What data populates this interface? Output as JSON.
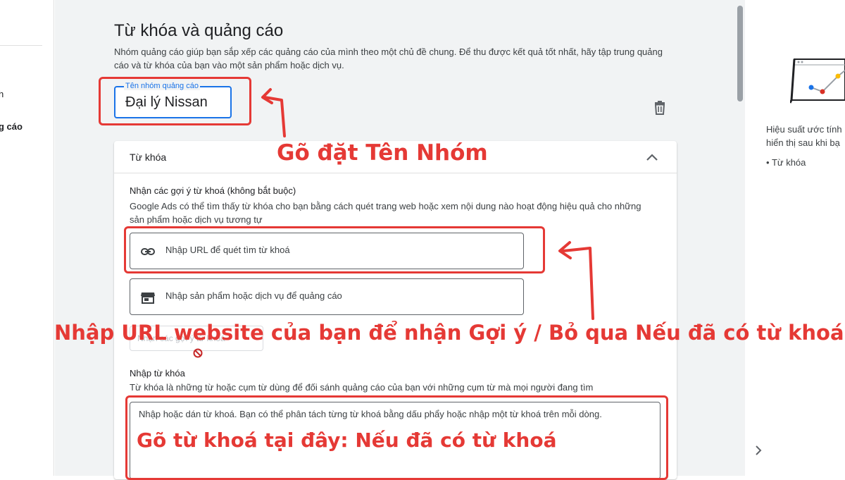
{
  "left_nav": {
    "items": [
      {
        "label": "h",
        "active": false
      },
      {
        "label": "g cáo",
        "active": true
      }
    ]
  },
  "page": {
    "title": "Từ khóa và quảng cáo",
    "description": "Nhóm quảng cáo giúp bạn sắp xếp các quảng cáo của mình theo một chủ đề chung. Để thu được kết quả tốt nhất, hãy tập trung quảng cáo và từ khóa của bạn vào một sản phẩm hoặc dịch vụ."
  },
  "ad_group": {
    "label": "Tên nhóm quảng cáo",
    "value": "Đại lý Nissan"
  },
  "keywords_card": {
    "header": "Từ khóa",
    "suggest_title": "Nhận các gợi ý từ khoá (không bắt buộc)",
    "suggest_desc": "Google Ads có thể tìm thấy từ khóa cho bạn bằng cách quét trang web hoặc xem nội dung nào hoạt động hiệu quả cho những sản phẩm hoặc dịch vụ tương tự",
    "url_option": "Nhập URL để quét tìm từ khoá",
    "product_option": "Nhập sản phẩm hoặc dịch vụ để quảng cáo",
    "ghost_button": "Nhận các gợi ý từ khoá",
    "enter_title": "Nhập từ khóa",
    "enter_desc": "Từ khóa là những từ hoặc cụm từ dùng để đối sánh quảng cáo của bạn với những cụm từ mà mọi người đang tìm",
    "textarea_placeholder": "Nhập hoặc dán từ khoá. Bạn có thể phân tách từng từ khoá bằng dấu phẩy hoặc nhập một từ khoá trên mỗi dòng."
  },
  "right_panel": {
    "line1": "Hiệu suất ước tính",
    "line2": "hiển thị sau khi bạ",
    "bullet": "Từ khóa"
  },
  "annotations": {
    "name_hint": "Gõ đặt Tên Nhóm",
    "url_hint": "Nhập URL website của bạn để nhận Gợi ý / Bỏ qua Nếu đã có từ khoá",
    "keyword_hint": "Gõ từ khoá tại đây: Nếu đã có từ khoá"
  },
  "colors": {
    "annotation_red": "#e53935",
    "focus_blue": "#1a73e8",
    "background_gray": "#f1f3f4"
  },
  "icons": [
    "trash-icon",
    "chevron-up-icon",
    "link-icon",
    "store-icon",
    "no-entry-icon",
    "chevron-right-icon"
  ]
}
